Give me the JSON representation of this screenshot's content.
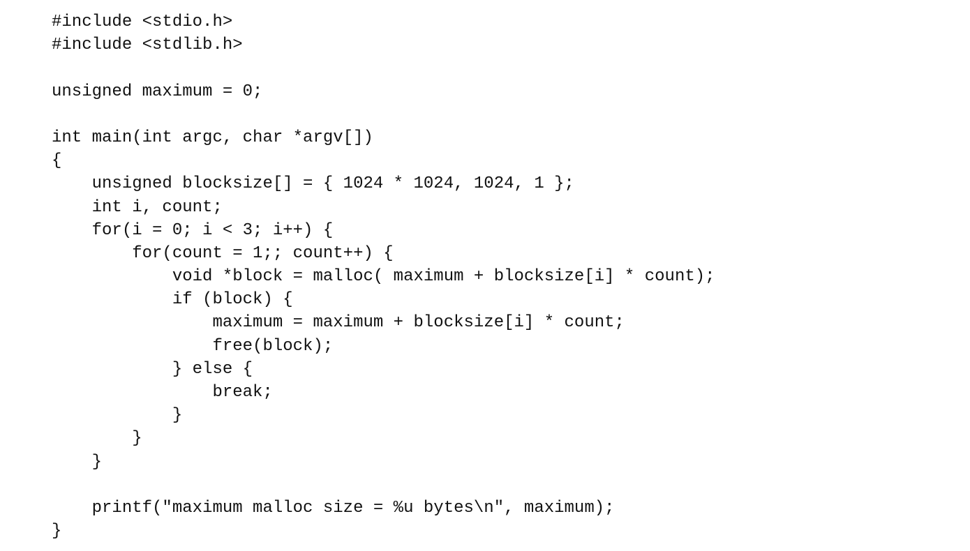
{
  "code": {
    "lines": [
      "#include <stdio.h>",
      "#include <stdlib.h>",
      "",
      "unsigned maximum = 0;",
      "",
      "int main(int argc, char *argv[])",
      "{",
      "    unsigned blocksize[] = { 1024 * 1024, 1024, 1 };",
      "    int i, count;",
      "    for(i = 0; i < 3; i++) {",
      "        for(count = 1;; count++) {",
      "            void *block = malloc( maximum + blocksize[i] * count);",
      "            if (block) {",
      "                maximum = maximum + blocksize[i] * count;",
      "                free(block);",
      "            } else {",
      "                break;",
      "            }",
      "        }",
      "    }",
      "",
      "    printf(\"maximum malloc size = %u bytes\\n\", maximum);",
      "}"
    ]
  }
}
